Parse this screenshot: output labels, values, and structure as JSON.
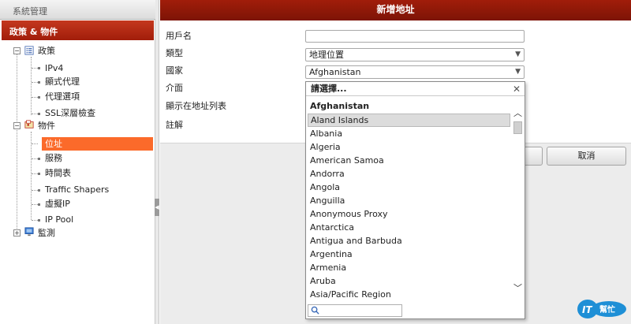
{
  "sidebar": {
    "system_header": "系統管理",
    "policy_header": "政策 & 物件",
    "tree": {
      "policy": "政策",
      "ipv4": "IPv4",
      "explicit_proxy": "顯式代理",
      "proxy_options": "代理選項",
      "ssl_inspection": "SSL深層檢查",
      "objects": "物件",
      "address": "位址",
      "services": "服務",
      "schedules": "時間表",
      "traffic_shapers": "Traffic Shapers",
      "virtual_ip": "虛擬IP",
      "ip_pool": "IP Pool",
      "monitor": "監測"
    }
  },
  "panel": {
    "title": "新增地址",
    "labels": {
      "username": "用戶名",
      "type": "類型",
      "country": "國家",
      "interface": "介面",
      "show_in_list": "顯示在地址列表",
      "comment": "註解"
    },
    "type_value": "地理位置",
    "country_value": "Afghanistan",
    "cancel_label": "取消"
  },
  "dropdown": {
    "header": "請選擇...",
    "group": "Afghanistan",
    "items": [
      "Aland Islands",
      "Albania",
      "Algeria",
      "American Samoa",
      "Andorra",
      "Angola",
      "Anguilla",
      "Anonymous Proxy",
      "Antarctica",
      "Antigua and Barbuda",
      "Argentina",
      "Armenia",
      "Aruba",
      "Asia/Pacific Region"
    ],
    "highlighted": "Aland Islands"
  },
  "watermark": {
    "badge": "IT",
    "text": "幫忙"
  }
}
